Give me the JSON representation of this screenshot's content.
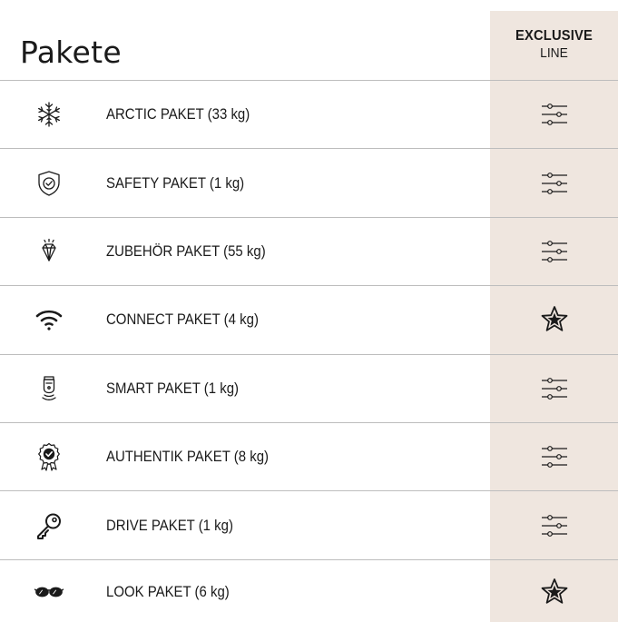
{
  "header": {
    "title": "Pakete",
    "column_line1": "EXCLUSIVE",
    "column_line2": "LINE"
  },
  "colors": {
    "column_background": "#efe6df",
    "divider": "#bdbdbd",
    "text": "#1a1a1a"
  },
  "rows": [
    {
      "icon": "snowflake-icon",
      "label": "ARCTIC PAKET (33 kg)",
      "status": "optional-sliders-icon"
    },
    {
      "icon": "shield-check-icon",
      "label": "SAFETY PAKET (1 kg)",
      "status": "optional-sliders-icon"
    },
    {
      "icon": "diamond-icon",
      "label": "ZUBEHÖR PAKET (55 kg)",
      "status": "optional-sliders-icon"
    },
    {
      "icon": "wifi-icon",
      "label": "CONNECT PAKET (4 kg)",
      "status": "standard-star-icon"
    },
    {
      "icon": "smart-sensor-icon",
      "label": "SMART PAKET (1 kg)",
      "status": "optional-sliders-icon"
    },
    {
      "icon": "certified-badge-icon",
      "label": "AUTHENTIK PAKET (8 kg)",
      "status": "optional-sliders-icon"
    },
    {
      "icon": "key-icon",
      "label": "DRIVE PAKET (1 kg)",
      "status": "optional-sliders-icon"
    },
    {
      "icon": "sunglasses-icon",
      "label": "LOOK PAKET (6 kg)",
      "status": "standard-star-icon"
    }
  ]
}
